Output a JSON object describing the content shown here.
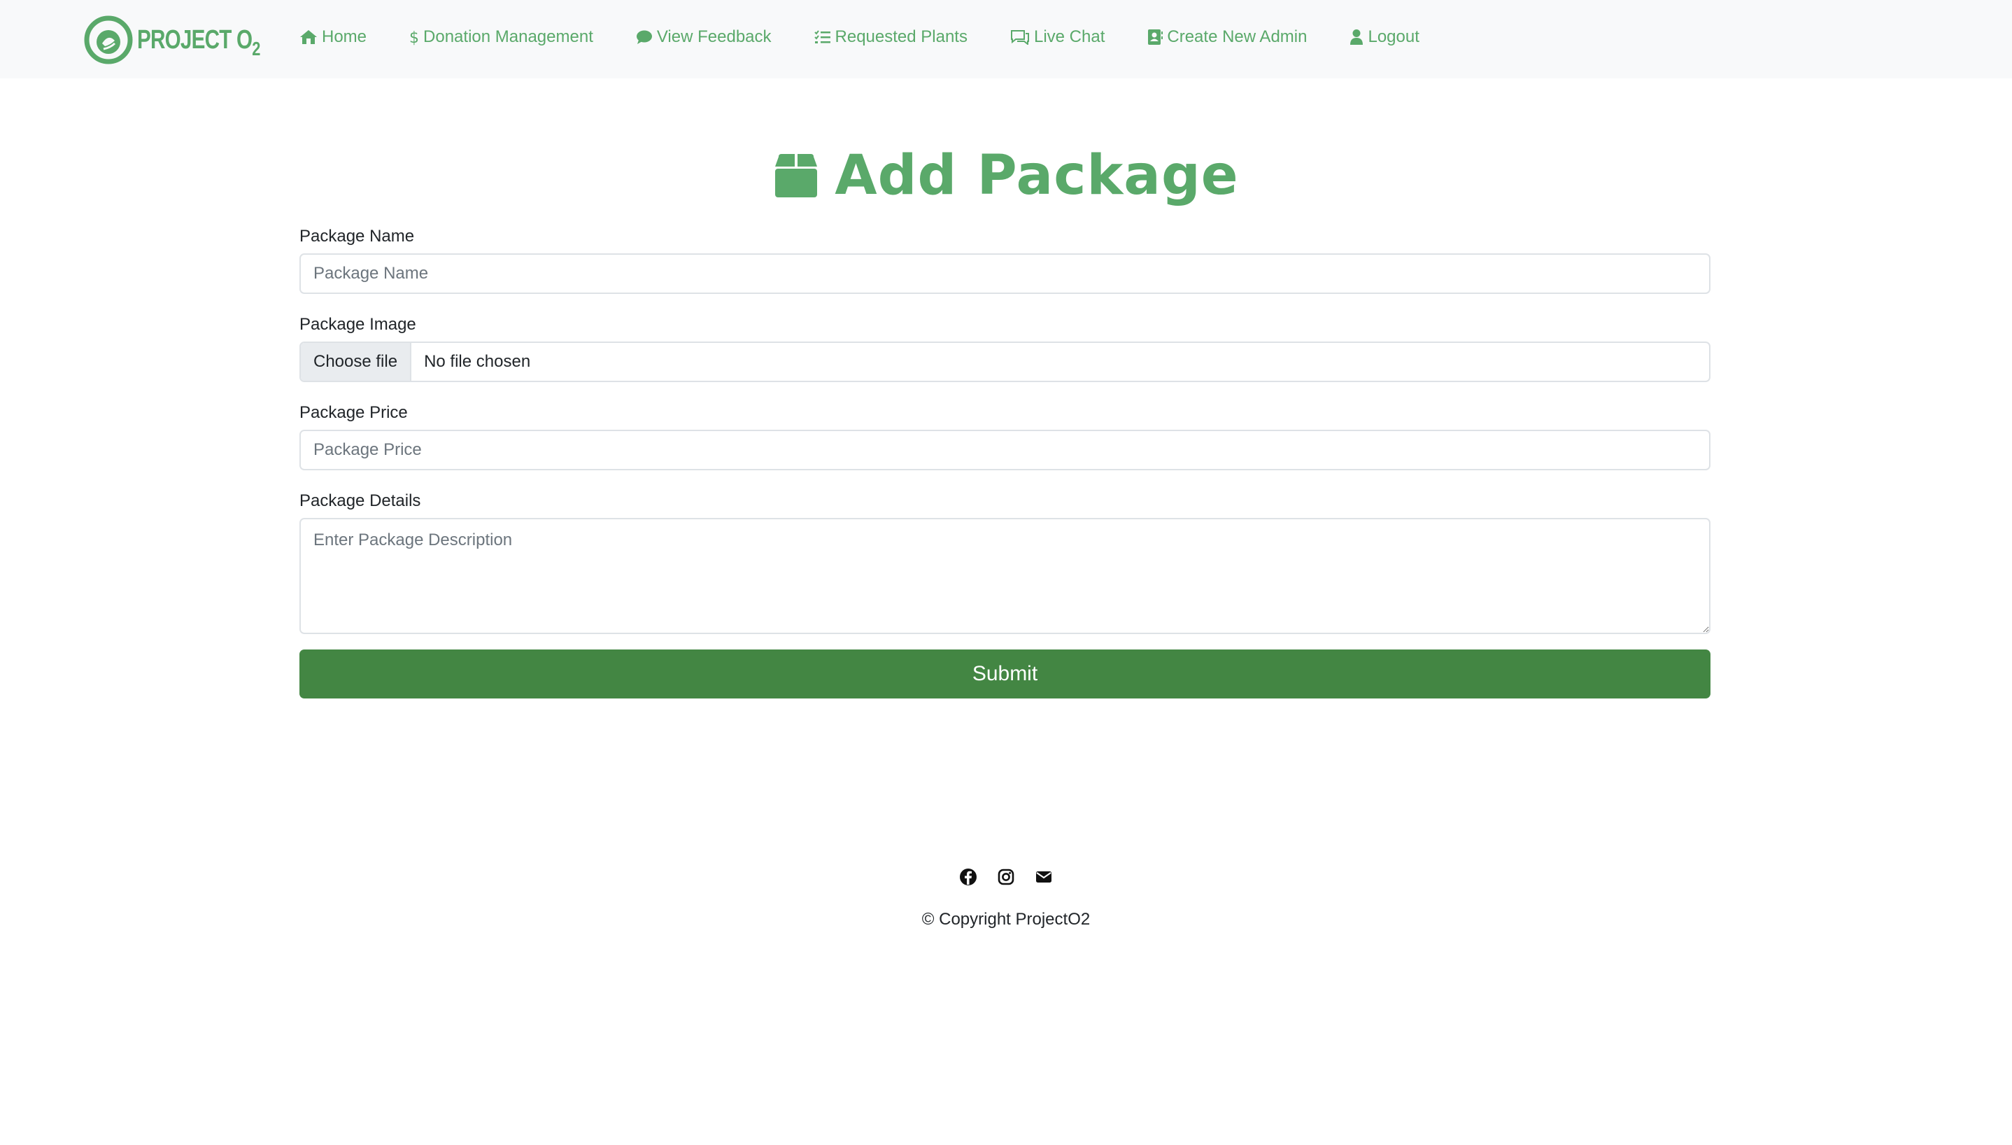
{
  "brand": {
    "logo_text": "PROJECT O",
    "logo_sub": "2"
  },
  "nav": {
    "items": [
      {
        "label": "Home",
        "icon": "home-icon"
      },
      {
        "label": "Donation Management",
        "icon": "dollar-icon"
      },
      {
        "label": "View Feedback",
        "icon": "comment-icon"
      },
      {
        "label": "Requested Plants",
        "icon": "list-check-icon"
      },
      {
        "label": "Live Chat",
        "icon": "chat-icon"
      },
      {
        "label": "Create New Admin",
        "icon": "contact-book-icon"
      },
      {
        "label": "Logout",
        "icon": "user-icon"
      }
    ]
  },
  "page": {
    "title": "Add Package",
    "title_icon": "box-icon"
  },
  "form": {
    "name_label": "Package Name",
    "name_placeholder": "Package Name",
    "image_label": "Package Image",
    "file_button": "Choose file",
    "file_status": "No file chosen",
    "price_label": "Package Price",
    "price_placeholder": "Package Price",
    "details_label": "Package Details",
    "details_placeholder": "Enter Package Description",
    "submit_label": "Submit"
  },
  "footer": {
    "social": [
      "facebook-icon",
      "instagram-icon",
      "envelope-icon"
    ],
    "copyright": "© Copyright ProjectO2"
  },
  "colors": {
    "accent": "#5aa96a",
    "submit_bg": "#438643",
    "navbar_bg": "#f8f9fa"
  }
}
